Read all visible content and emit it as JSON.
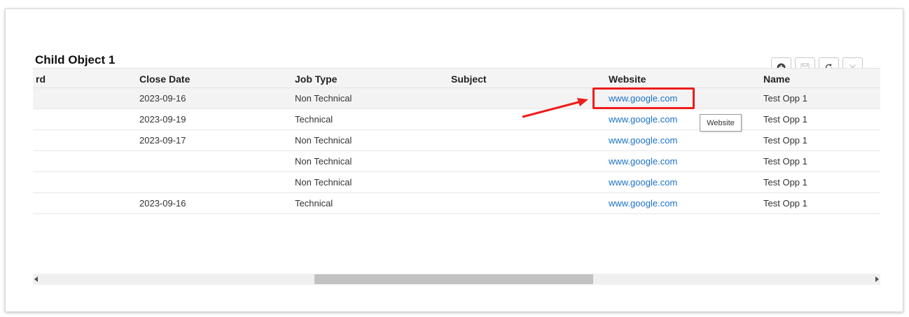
{
  "panel": {
    "title": "Child Object 1",
    "toolbar": [
      {
        "icon": "plus-circle-icon",
        "label": "add"
      },
      {
        "icon": "save-icon",
        "label": "save"
      },
      {
        "icon": "refresh-icon",
        "label": "refresh"
      },
      {
        "icon": "close-icon",
        "label": "close"
      }
    ]
  },
  "grid": {
    "columns": [
      "rd",
      "Close Date",
      "Job Type",
      "Subject",
      "Website",
      "Name"
    ],
    "rows": [
      {
        "rd": "",
        "close_date": "2023-09-16",
        "job_type": "Non Technical",
        "subject": "",
        "website": "www.google.com",
        "name": "Test Opp 1"
      },
      {
        "rd": "",
        "close_date": "2023-09-19",
        "job_type": "Technical",
        "subject": "",
        "website": "www.google.com",
        "name": "Test Opp 1"
      },
      {
        "rd": "",
        "close_date": "2023-09-17",
        "job_type": "Non Technical",
        "subject": "",
        "website": "www.google.com",
        "name": "Test Opp 1"
      },
      {
        "rd": "",
        "close_date": "",
        "job_type": "Non Technical",
        "subject": "",
        "website": "www.google.com",
        "name": "Test Opp 1"
      },
      {
        "rd": "",
        "close_date": "",
        "job_type": "Non Technical",
        "subject": "",
        "website": "www.google.com",
        "name": "Test Opp 1"
      },
      {
        "rd": "",
        "close_date": "2023-09-16",
        "job_type": "Technical",
        "subject": "",
        "website": "www.google.com",
        "name": "Test Opp 1"
      }
    ]
  },
  "tooltip": {
    "text": "Website"
  },
  "annotation": {
    "color": "#ee1c1c"
  },
  "colors": {
    "link": "#1a73c8",
    "header_bg": "#f4f4f4",
    "row_highlight": "#f3f3f3"
  }
}
